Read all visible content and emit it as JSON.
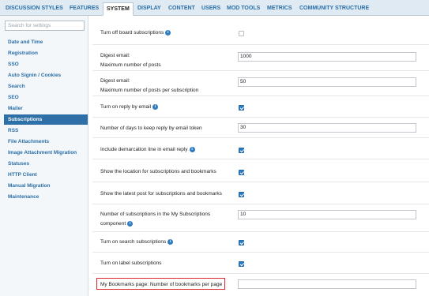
{
  "nav": {
    "tabs": [
      "DISCUSSION STYLES",
      "FEATURES",
      "SYSTEM",
      "DISPLAY",
      "CONTENT",
      "USERS",
      "MOD TOOLS",
      "METRICS",
      "COMMUNITY STRUCTURE"
    ],
    "active": "SYSTEM"
  },
  "sidebar": {
    "search_placeholder": "Search for settings",
    "items": [
      "Date and Time",
      "Registration",
      "SSO",
      "Auto Signin / Cookies",
      "Search",
      "SEO",
      "Mailer",
      "Subscriptions",
      "RSS",
      "File Attachments",
      "Image Attachment Migration",
      "Statuses",
      "HTTP Client",
      "Manual Migration",
      "Maintenance"
    ],
    "active": "Subscriptions"
  },
  "settings": [
    {
      "label": "Turn off board subscriptions",
      "info": true,
      "control": "checkbox",
      "checked": false
    },
    {
      "label": "Digest email:",
      "sub": "Maximum number of posts",
      "control": "text",
      "value": "1000"
    },
    {
      "label": "Digest email:",
      "sub": "Maximum number of posts per subscription",
      "control": "text",
      "value": "50"
    },
    {
      "label": "Turn on reply by email",
      "info": true,
      "control": "checkbox",
      "checked": true
    },
    {
      "label": "Number of days to keep reply by email token",
      "control": "text",
      "value": "30"
    },
    {
      "label": "Include demarcation line in email reply",
      "info": true,
      "control": "checkbox",
      "checked": true
    },
    {
      "label": "Show the location for subscriptions and bookmarks",
      "control": "checkbox",
      "checked": true
    },
    {
      "label": "Show the latest post for subscriptions and bookmarks",
      "control": "checkbox",
      "checked": true
    },
    {
      "label": "Number of subscriptions in the My Subscriptions",
      "sub": "component",
      "info": true,
      "control": "text",
      "value": "10"
    },
    {
      "label": "Turn on search subscriptions",
      "info": true,
      "control": "checkbox",
      "checked": true
    },
    {
      "label": "Turn on label subscriptions",
      "control": "checkbox",
      "checked": true
    },
    {
      "label": "My Bookmarks page: Number of bookmarks per page",
      "control": "text",
      "value": "",
      "highlighted": true
    }
  ],
  "colors": {
    "accent": "#2d6fa6",
    "link": "#2a6fa8",
    "highlight": "#d9262b",
    "nav_bg": "#dfeaf2"
  },
  "icons": {
    "info": "info-icon",
    "checkbox": "checkbox-icon"
  }
}
